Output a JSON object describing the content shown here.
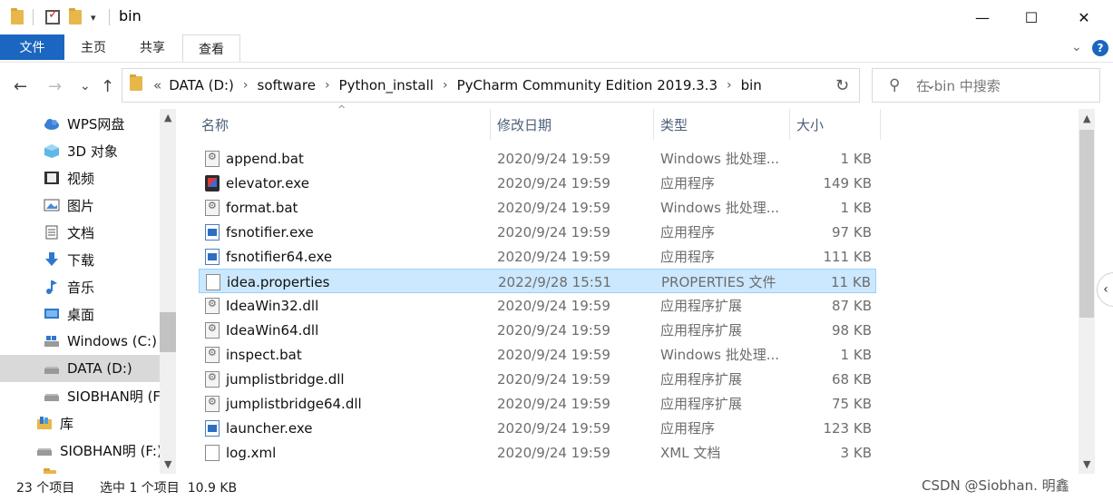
{
  "window": {
    "title": "bin",
    "minimize_glyph": "—",
    "maximize_glyph": "☐",
    "close_glyph": "✕"
  },
  "ribbon": {
    "tabs": [
      "文件",
      "主页",
      "共享",
      "查看"
    ],
    "collapse_glyph": "⌄",
    "help_glyph": "?"
  },
  "nav": {
    "back_glyph": "←",
    "forward_glyph": "→",
    "recent_glyph": "⌄",
    "up_glyph": "↑",
    "overflow": "«",
    "crumbs": [
      "DATA (D:)",
      "software",
      "Python_install",
      "PyCharm Community Edition 2019.3.3",
      "bin"
    ],
    "crumb_sep": "›",
    "dropdown_glyph": "⌄",
    "refresh_glyph": "↻"
  },
  "search": {
    "placeholder": "在 bin 中搜索",
    "icon_glyph": "⚲"
  },
  "sidebar": {
    "items": [
      {
        "label": "WPS网盘",
        "icon": "cloud-icon"
      },
      {
        "label": "3D 对象",
        "icon": "cube-icon"
      },
      {
        "label": "视频",
        "icon": "video-icon"
      },
      {
        "label": "图片",
        "icon": "picture-icon"
      },
      {
        "label": "文档",
        "icon": "document-icon"
      },
      {
        "label": "下载",
        "icon": "download-icon"
      },
      {
        "label": "音乐",
        "icon": "music-icon"
      },
      {
        "label": "桌面",
        "icon": "desktop-icon"
      },
      {
        "label": "Windows (C:)",
        "icon": "drive-icon"
      },
      {
        "label": "DATA (D:)",
        "icon": "drive-icon",
        "selected": true
      },
      {
        "label": "SIOBHAN明 (F",
        "icon": "usb-drive-icon"
      },
      {
        "label": "库",
        "icon": "library-icon"
      },
      {
        "label": "SIOBHAN明 (F:)",
        "icon": "usb-drive-icon"
      }
    ]
  },
  "columns": {
    "name": "名称",
    "date": "修改日期",
    "type": "类型",
    "size": "大小",
    "sort_glyph": "^"
  },
  "files": [
    {
      "name": "append.bat",
      "date": "2020/9/24 19:59",
      "type": "Windows 批处理...",
      "size": "1 KB",
      "icon": "batch-file-icon"
    },
    {
      "name": "elevator.exe",
      "date": "2020/9/24 19:59",
      "type": "应用程序",
      "size": "149 KB",
      "icon": "elevator-app-icon"
    },
    {
      "name": "format.bat",
      "date": "2020/9/24 19:59",
      "type": "Windows 批处理...",
      "size": "1 KB",
      "icon": "batch-file-icon"
    },
    {
      "name": "fsnotifier.exe",
      "date": "2020/9/24 19:59",
      "type": "应用程序",
      "size": "97 KB",
      "icon": "exe-icon"
    },
    {
      "name": "fsnotifier64.exe",
      "date": "2020/9/24 19:59",
      "type": "应用程序",
      "size": "111 KB",
      "icon": "exe-icon"
    },
    {
      "name": "idea.properties",
      "date": "2022/9/28 15:51",
      "type": "PROPERTIES 文件",
      "size": "11 KB",
      "icon": "file-icon",
      "selected": true
    },
    {
      "name": "IdeaWin32.dll",
      "date": "2020/9/24 19:59",
      "type": "应用程序扩展",
      "size": "87 KB",
      "icon": "dll-icon"
    },
    {
      "name": "IdeaWin64.dll",
      "date": "2020/9/24 19:59",
      "type": "应用程序扩展",
      "size": "98 KB",
      "icon": "dll-icon"
    },
    {
      "name": "inspect.bat",
      "date": "2020/9/24 19:59",
      "type": "Windows 批处理...",
      "size": "1 KB",
      "icon": "batch-file-icon"
    },
    {
      "name": "jumplistbridge.dll",
      "date": "2020/9/24 19:59",
      "type": "应用程序扩展",
      "size": "68 KB",
      "icon": "dll-icon"
    },
    {
      "name": "jumplistbridge64.dll",
      "date": "2020/9/24 19:59",
      "type": "应用程序扩展",
      "size": "75 KB",
      "icon": "dll-icon"
    },
    {
      "name": "launcher.exe",
      "date": "2020/9/24 19:59",
      "type": "应用程序",
      "size": "123 KB",
      "icon": "exe-icon"
    },
    {
      "name": "log.xml",
      "date": "2020/9/24 19:59",
      "type": "XML 文档",
      "size": "3 KB",
      "icon": "file-icon"
    }
  ],
  "status": {
    "count": "23 个项目",
    "selection": "选中 1 个项目  10.9 KB"
  },
  "watermark": "CSDN @Siobhan. 明鑫",
  "colors": {
    "accent": "#1a66c0",
    "selection_bg": "#cce8ff",
    "selection_border": "#99d1ff"
  }
}
